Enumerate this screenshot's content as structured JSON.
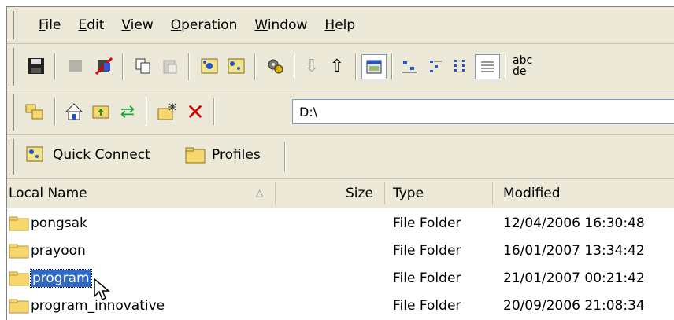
{
  "menu": {
    "items": [
      {
        "label": "File",
        "key": "F",
        "rest": "ile"
      },
      {
        "label": "Edit",
        "key": "E",
        "rest": "dit"
      },
      {
        "label": "View",
        "key": "V",
        "rest": "iew"
      },
      {
        "label": "Operation",
        "key": "O",
        "rest": "peration"
      },
      {
        "label": "Window",
        "key": "W",
        "rest": "indow"
      },
      {
        "label": "Help",
        "key": "H",
        "rest": "elp"
      }
    ]
  },
  "toolbar": {
    "view_text_partial": "abc\nde"
  },
  "address": {
    "path": "D:\\"
  },
  "quick_bar": {
    "quick_connect": "Quick Connect",
    "profiles": "Profiles"
  },
  "columns": {
    "name": "Local Name",
    "size": "Size",
    "type": "Type",
    "modified": "Modified"
  },
  "rows": [
    {
      "name": "pongsak",
      "size": "",
      "type": "File Folder",
      "modified": "12/04/2006 16:30:48"
    },
    {
      "name": "prayoon",
      "size": "",
      "type": "File Folder",
      "modified": "16/01/2007 13:34:42"
    },
    {
      "name": "program",
      "size": "",
      "type": "File Folder",
      "modified": "21/01/2007 00:21:42"
    },
    {
      "name": "program_innovative",
      "size": "",
      "type": "File Folder",
      "modified": "20/09/2006 21:08:34"
    }
  ],
  "colors": {
    "selection": "#316ac5",
    "folder": "#f5d76e",
    "delete": "#cc0000"
  }
}
